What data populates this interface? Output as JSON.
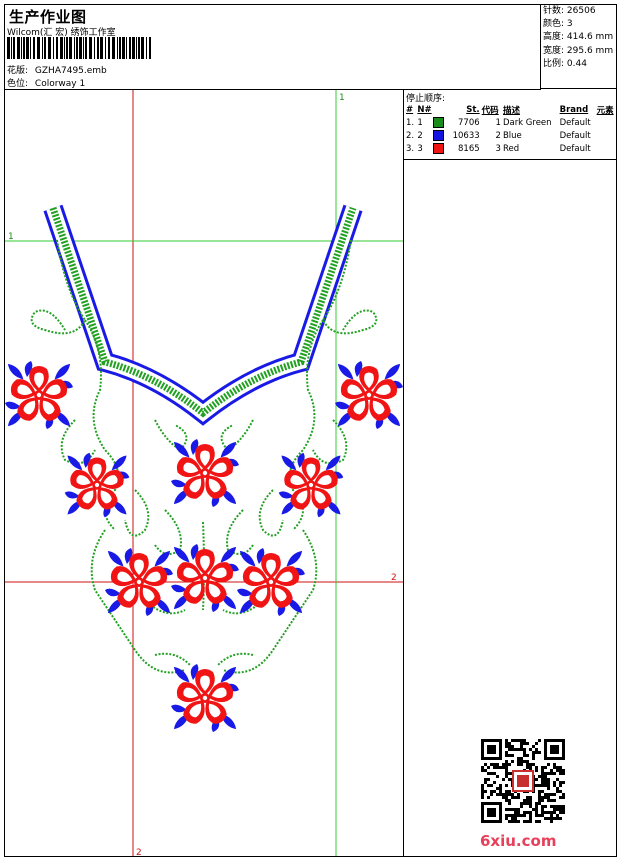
{
  "header": {
    "title": "生产作业图",
    "subtitle": "Wilcom(汇 宏) 绣饰工作室",
    "design_label": "花版:",
    "design_value": "GZHA7495.emb",
    "colorway_label": "色位:",
    "colorway_value": "Colorway 1"
  },
  "stats": [
    {
      "label": "针数:",
      "value": "26506"
    },
    {
      "label": "颜色:",
      "value": "3"
    },
    {
      "label": "高度:",
      "value": "414.6 mm"
    },
    {
      "label": "宽度:",
      "value": "295.6 mm"
    },
    {
      "label": "比例:",
      "value": "0.44"
    }
  ],
  "stop_sequence": {
    "title": "停止顺序:",
    "headers": [
      "#",
      "N#",
      "St.",
      "代码",
      "描述",
      "Brand",
      "元素"
    ],
    "rows": [
      {
        "num": "1.",
        "n": "1",
        "color": "#1a8c1a",
        "stitches": "7706",
        "code": "1",
        "desc": "Dark Green",
        "brand": "Default",
        "element": ""
      },
      {
        "num": "2.",
        "n": "2",
        "color": "#1414e0",
        "stitches": "10633",
        "code": "2",
        "desc": "Blue",
        "brand": "Default",
        "element": ""
      },
      {
        "num": "3.",
        "n": "3",
        "color": "#f01414",
        "stitches": "8165",
        "code": "3",
        "desc": "Red",
        "brand": "Default",
        "element": ""
      }
    ]
  },
  "grid_labels": {
    "v1": "1",
    "h1": "1",
    "h2": "2",
    "v2": "2"
  },
  "colors": {
    "green": "#22a022",
    "blue": "#1a1ae6",
    "red": "#f01414",
    "guide_green": "#33cc33",
    "guide_red": "#cc1111"
  },
  "watermark": "6xiu.com"
}
